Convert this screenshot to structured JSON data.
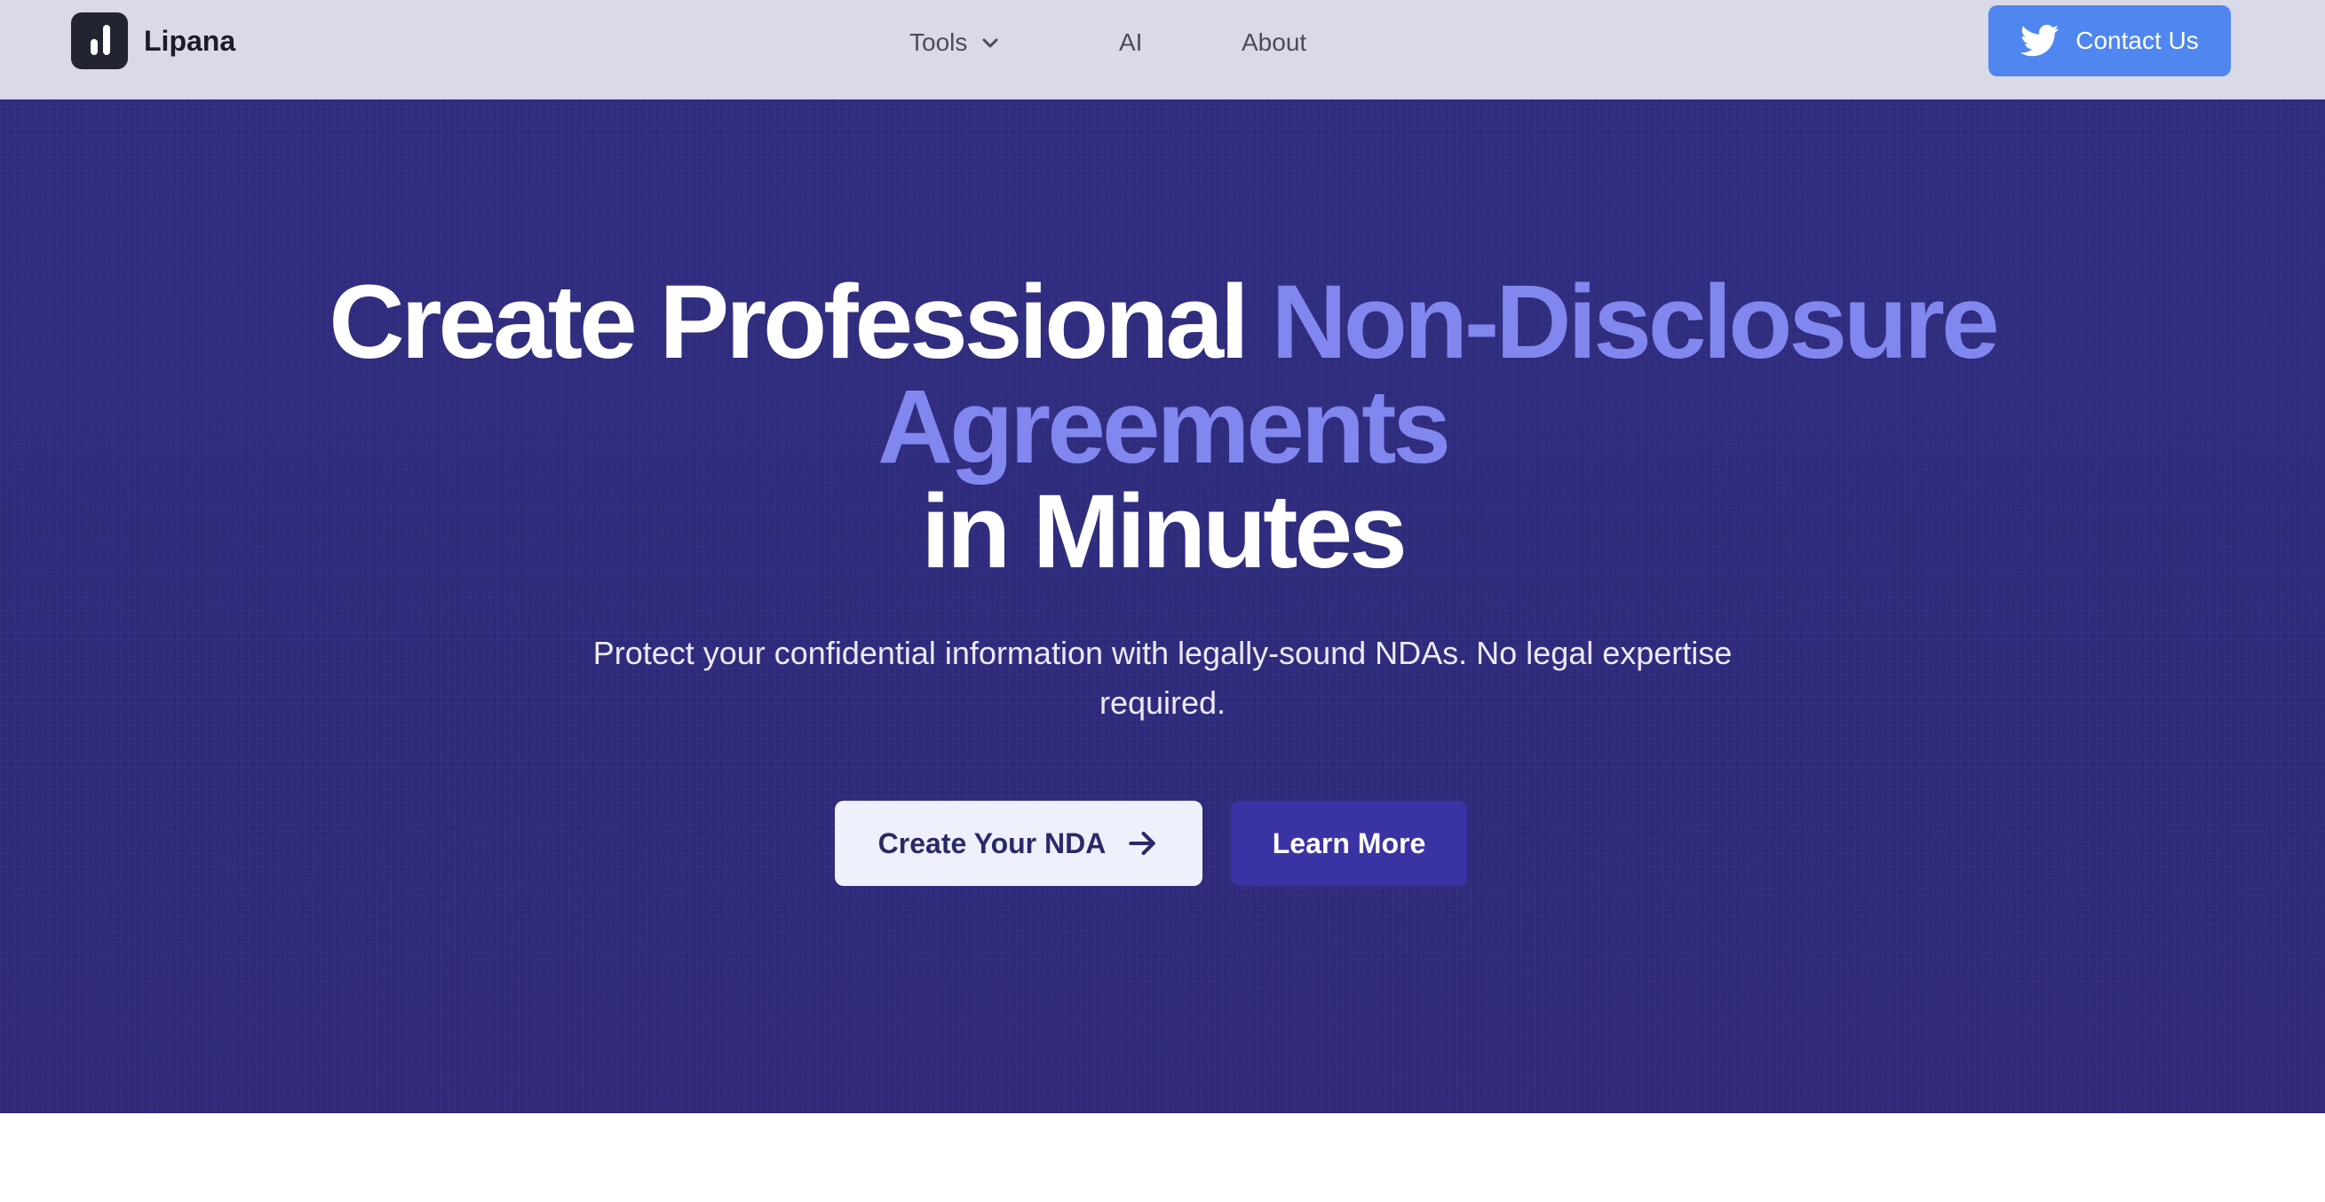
{
  "brand": {
    "name": "Lipana",
    "logo_icon": "bar-chart-logo-icon"
  },
  "nav": {
    "tools_label": "Tools",
    "tools_icon": "chevron-down-icon",
    "ai_label": "AI",
    "about_label": "About"
  },
  "contact": {
    "label": "Contact Us",
    "icon": "twitter-bird-icon"
  },
  "hero": {
    "headline_part1": "Create Professional ",
    "headline_accent1": "Non-Disclosure",
    "headline_accent2": "Agreements",
    "headline_part2": "in Minutes",
    "subtitle": "Protect your confidential information with legally-sound NDAs. No legal expertise required.",
    "primary_cta": "Create Your NDA",
    "primary_cta_icon": "arrow-right-icon",
    "secondary_cta": "Learn More"
  },
  "colors": {
    "nav_bg": "#d9d9e8",
    "hero_bg": "#2e2a7d",
    "accent_text": "#8187ee",
    "contact_btn": "#4f86f0",
    "secondary_btn": "#3a33a4"
  }
}
